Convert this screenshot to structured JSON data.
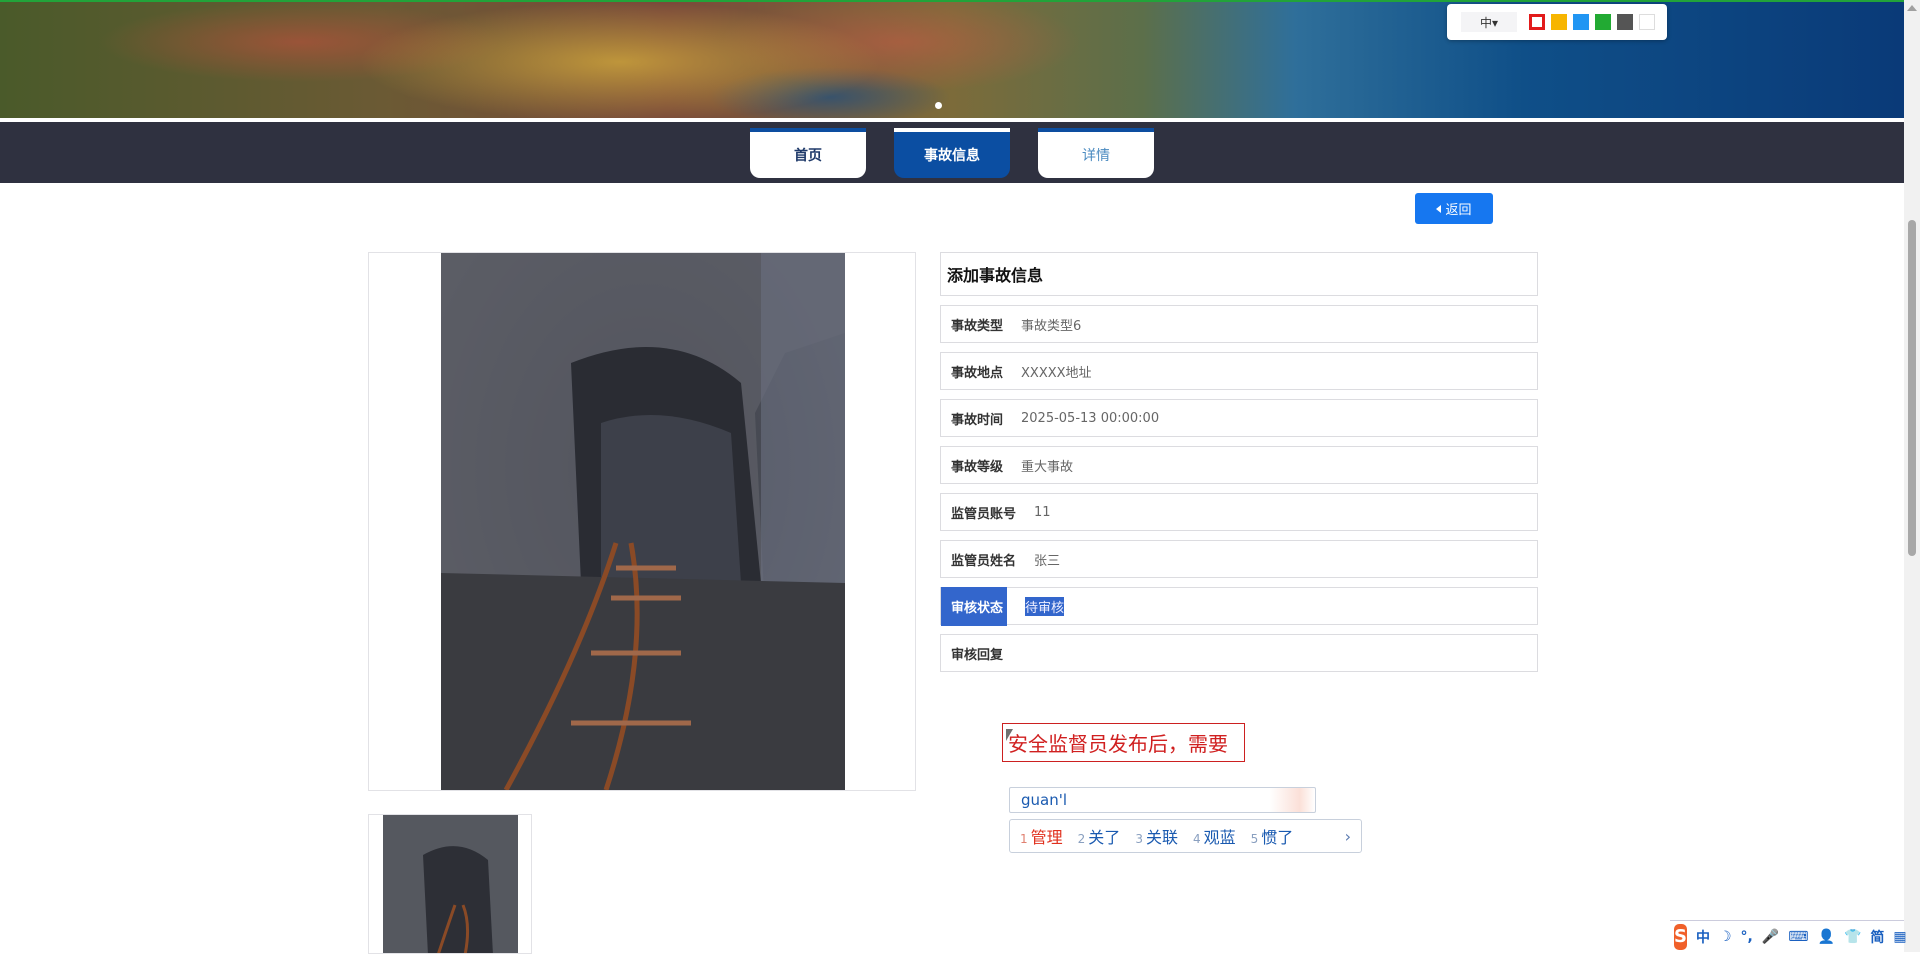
{
  "palette": {
    "size_label": "中▾",
    "colors": [
      "#e21b1b",
      "#f7b500",
      "#2196f3",
      "#22aa33",
      "#555555",
      "#ffffff"
    ]
  },
  "nav": {
    "tabs": [
      {
        "label": "首页"
      },
      {
        "label": "事故信息"
      },
      {
        "label": "详情"
      }
    ]
  },
  "back_label": "返回",
  "form": {
    "title": "添加事故信息",
    "rows": [
      {
        "label": "事故类型",
        "value": "事故类型6"
      },
      {
        "label": "事故地点",
        "value": "XXXXX地址"
      },
      {
        "label": "事故时间",
        "value": "2025-05-13 00:00:00"
      },
      {
        "label": "事故等级",
        "value": "重大事故"
      },
      {
        "label": "监管员账号",
        "value": "11"
      },
      {
        "label": "监管员姓名",
        "value": "张三"
      },
      {
        "label": "审核状态",
        "value": "待审核"
      },
      {
        "label": "审核回复",
        "value": ""
      }
    ]
  },
  "editing_text": "安全监督员发布后，需要",
  "ime": {
    "input": "guan'l",
    "candidates": [
      {
        "n": "1",
        "t": "管理"
      },
      {
        "n": "2",
        "t": "关了"
      },
      {
        "n": "3",
        "t": "关联"
      },
      {
        "n": "4",
        "t": "观蓝"
      },
      {
        "n": "5",
        "t": "惯了"
      }
    ],
    "more": "›"
  },
  "sogou_bar": {
    "logo": "S",
    "items": [
      "中",
      "☽",
      "°,",
      "🎤",
      "⌨",
      "👤",
      "👕",
      "简",
      "▦"
    ]
  }
}
